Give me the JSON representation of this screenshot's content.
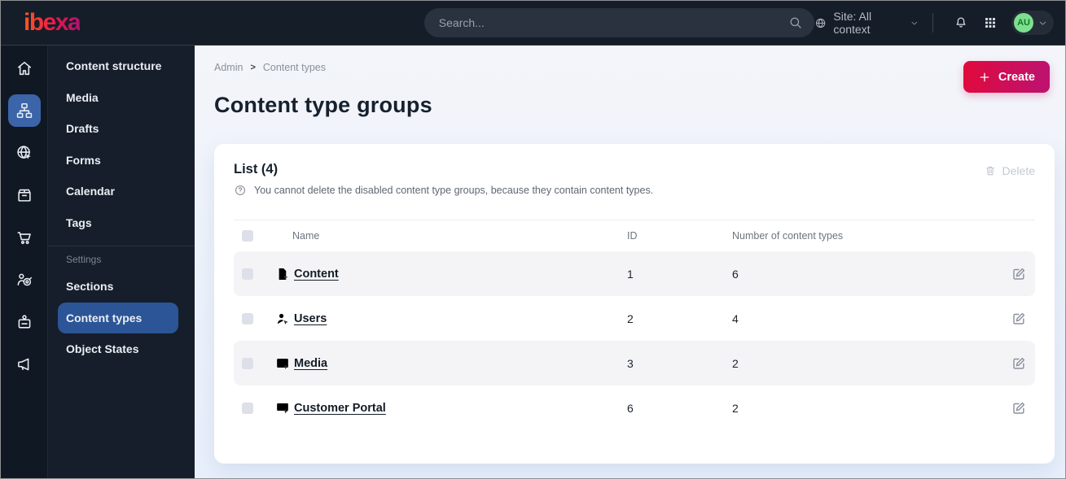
{
  "topbar": {
    "logo_text": "ibexa",
    "search_placeholder": "Search...",
    "site_selector": "Site: All context",
    "avatar_initials": "AU"
  },
  "sidebar_rail": {
    "items": [
      {
        "icon": "home-icon",
        "active": false
      },
      {
        "icon": "content-structure-icon",
        "active": true
      },
      {
        "icon": "site-globe-icon",
        "active": false
      },
      {
        "icon": "product-catalog-icon",
        "active": false
      },
      {
        "icon": "commerce-cart-icon",
        "active": false
      },
      {
        "icon": "personalization-target-icon",
        "active": false
      },
      {
        "icon": "admin-badge-icon",
        "active": false
      },
      {
        "icon": "marketing-megaphone-icon",
        "active": false
      }
    ]
  },
  "sidebar_menu": {
    "main_items": [
      {
        "label": "Content structure"
      },
      {
        "label": "Media"
      },
      {
        "label": "Drafts"
      },
      {
        "label": "Forms"
      },
      {
        "label": "Calendar"
      },
      {
        "label": "Tags"
      }
    ],
    "section_label": "Settings",
    "settings_items": [
      {
        "label": "Sections",
        "active": false
      },
      {
        "label": "Content types",
        "active": true
      },
      {
        "label": "Object States",
        "active": false
      }
    ]
  },
  "breadcrumb": {
    "items": [
      "Admin",
      "Content types"
    ],
    "separator": ">"
  },
  "page": {
    "title": "Content type groups",
    "create_button": "Create"
  },
  "list_panel": {
    "title": "List (4)",
    "info_text": "You cannot delete the disabled content type groups, because they contain content types.",
    "delete_button": "Delete",
    "table": {
      "columns": [
        "Name",
        "ID",
        "Number of content types"
      ],
      "rows": [
        {
          "icon": "file-icon",
          "name": "Content",
          "id": "1",
          "content_types_count": "6"
        },
        {
          "icon": "user-icon",
          "name": "Users",
          "id": "2",
          "content_types_count": "4"
        },
        {
          "icon": "image-icon",
          "name": "Media",
          "id": "3",
          "content_types_count": "2"
        },
        {
          "icon": "monitor-icon",
          "name": "Customer Portal",
          "id": "6",
          "content_types_count": "2"
        }
      ]
    }
  },
  "colors": {
    "topbar_bg": "#151D28",
    "rail_active_blue": "#3C64A8",
    "menu_active_blue": "#2B5596",
    "accent_gradient_start": "#E00A3C",
    "accent_gradient_end": "#BC1272",
    "avatar_green": "#7CE08F",
    "zebra_row": "#F4F4F7"
  }
}
